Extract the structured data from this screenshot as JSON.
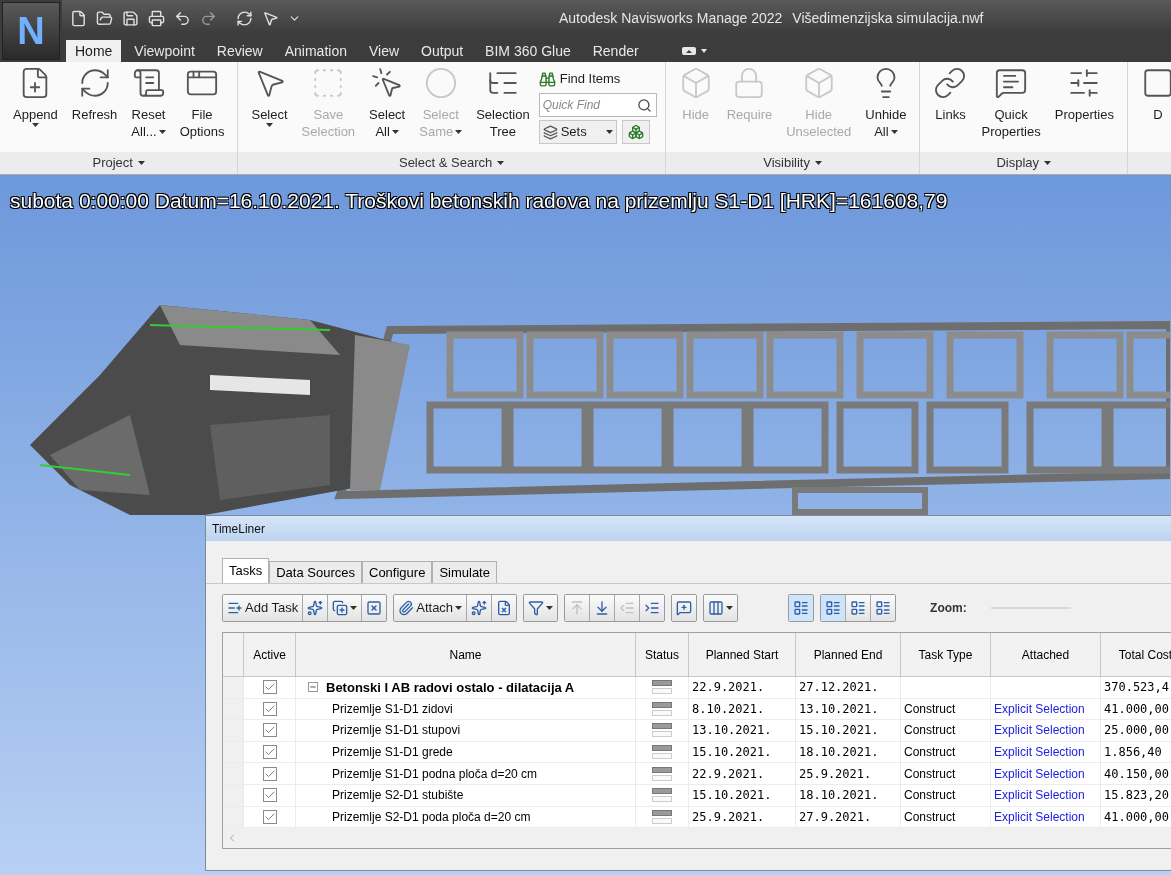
{
  "window": {
    "logo": "N",
    "title": "Autodesk Navisworks Manage 2022",
    "file": "Višedimenzijska simulacija.nwf"
  },
  "tabs": [
    {
      "label": "Home",
      "selected": true
    },
    {
      "label": "Viewpoint",
      "selected": false
    },
    {
      "label": "Review",
      "selected": false
    },
    {
      "label": "Animation",
      "selected": false
    },
    {
      "label": "View",
      "selected": false
    },
    {
      "label": "Output",
      "selected": false
    },
    {
      "label": "BIM 360 Glue",
      "selected": false
    },
    {
      "label": "Render",
      "selected": false
    }
  ],
  "ribbon": {
    "groups": [
      {
        "label": "Project",
        "buttons": [
          {
            "lines": [
              "Append"
            ],
            "dropdown": true,
            "disabled": false
          },
          {
            "lines": [
              "Refresh"
            ],
            "dropdown": false,
            "disabled": false
          },
          {
            "lines": [
              "Reset",
              "All..."
            ],
            "dropdown": true,
            "disabled": false
          },
          {
            "lines": [
              "File",
              "Options"
            ],
            "dropdown": false,
            "disabled": false
          }
        ]
      },
      {
        "label": "Select & Search",
        "buttons": [
          {
            "lines": [
              "Select"
            ],
            "dropdown": true,
            "disabled": false
          },
          {
            "lines": [
              "Save",
              "Selection"
            ],
            "dropdown": false,
            "disabled": true
          },
          {
            "lines": [
              "Select",
              "All"
            ],
            "dropdown": true,
            "disabled": false
          },
          {
            "lines": [
              "Select",
              "Same"
            ],
            "dropdown": true,
            "disabled": true
          },
          {
            "lines": [
              "Selection",
              "Tree"
            ],
            "dropdown": false,
            "disabled": false
          }
        ],
        "tools": {
          "find_label": "Find Items",
          "search": {
            "placeholder": "Quick Find"
          },
          "sets_label": "Sets"
        }
      },
      {
        "label": "Visibility",
        "buttons": [
          {
            "lines": [
              "Hide"
            ],
            "dropdown": false,
            "disabled": true
          },
          {
            "lines": [
              "Require"
            ],
            "dropdown": false,
            "disabled": true
          },
          {
            "lines": [
              "Hide",
              "Unselected"
            ],
            "dropdown": false,
            "disabled": true
          },
          {
            "lines": [
              "Unhide",
              "All"
            ],
            "dropdown": true,
            "disabled": false
          }
        ]
      },
      {
        "label": "Display",
        "buttons": [
          {
            "lines": [
              "Links"
            ],
            "dropdown": false,
            "disabled": false
          },
          {
            "lines": [
              "Quick",
              "Properties"
            ],
            "dropdown": false,
            "disabled": false
          },
          {
            "lines": [
              "Properties"
            ],
            "dropdown": false,
            "disabled": false
          }
        ]
      },
      {
        "buttons": [
          {
            "lines": [
              "D"
            ],
            "dropdown": false,
            "disabled": false
          }
        ]
      }
    ]
  },
  "viewport": {
    "caption": "subota 0:00:00 Datum=16.10.2021. Troškovi betonskih radova na prizemlju S1-D1 [HRK]=161608,79"
  },
  "timeliner": {
    "title": "TimeLiner",
    "tabs": [
      {
        "label": "Tasks",
        "selected": true
      },
      {
        "label": "Data Sources",
        "selected": false
      },
      {
        "label": "Configure",
        "selected": false
      },
      {
        "label": "Simulate",
        "selected": false
      }
    ],
    "toolbar": [
      [
        {
          "kind": "labeled",
          "label": "Add Task",
          "dropdown": false,
          "disabled": false
        },
        {
          "kind": "icon",
          "dropdown": false,
          "disabled": false
        },
        {
          "kind": "icon",
          "dropdown": true,
          "disabled": false
        },
        {
          "kind": "icon",
          "dropdown": false,
          "disabled": false
        }
      ],
      [
        {
          "kind": "labeled",
          "label": "Attach",
          "dropdown": true,
          "disabled": false
        },
        {
          "kind": "icon",
          "dropdown": false,
          "disabled": false
        },
        {
          "kind": "icon",
          "dropdown": false,
          "disabled": false
        }
      ],
      [
        {
          "kind": "icon",
          "dropdown": true,
          "disabled": false
        }
      ],
      [
        {
          "kind": "icon",
          "dropdown": false,
          "disabled": true
        },
        {
          "kind": "icon",
          "dropdown": false,
          "disabled": false
        },
        {
          "kind": "icon",
          "dropdown": false,
          "disabled": true
        },
        {
          "kind": "icon",
          "dropdown": false,
          "disabled": false
        }
      ],
      [
        {
          "kind": "icon",
          "dropdown": false,
          "disabled": false
        }
      ],
      [
        {
          "kind": "icon",
          "dropdown": true,
          "disabled": false
        }
      ],
      [
        {
          "kind": "view",
          "selected": true
        }
      ],
      [
        {
          "kind": "view",
          "selected": true
        },
        {
          "kind": "view",
          "selected": false
        },
        {
          "kind": "view",
          "selected": false
        }
      ]
    ],
    "zoom_label": "Zoom:",
    "columns": [
      "Active",
      "Name",
      "Status",
      "Planned Start",
      "Planned End",
      "Task Type",
      "Attached",
      "Total Cost"
    ],
    "rows": [
      {
        "active": true,
        "name": "Betonski I AB radovi ostalo - dilatacija A",
        "start": "22.9.2021.",
        "end": "27.12.2021.",
        "cost": "370.523,4",
        "expanded": true,
        "children": [
          {
            "active": true,
            "name": "Prizemlje S1-D1 zidovi",
            "start": "8.10.2021.",
            "end": "13.10.2021.",
            "task_type": "Construct",
            "attached": "Explicit Selection",
            "cost": "41.000,00"
          },
          {
            "active": true,
            "name": "Prizemlje S1-D1 stupovi",
            "start": "13.10.2021.",
            "end": "15.10.2021.",
            "task_type": "Construct",
            "attached": "Explicit Selection",
            "cost": "25.000,00"
          },
          {
            "active": true,
            "name": "Prizemlje S1-D1 grede",
            "start": "15.10.2021.",
            "end": "18.10.2021.",
            "task_type": "Construct",
            "attached": "Explicit Selection",
            "cost": "1.856,40"
          },
          {
            "active": true,
            "name": "Prizemlje S1-D1 podna ploča d=20 cm",
            "start": "22.9.2021.",
            "end": "25.9.2021.",
            "task_type": "Construct",
            "attached": "Explicit Selection",
            "cost": "40.150,00"
          },
          {
            "active": true,
            "name": "Prizemlje S2-D1 stubište",
            "start": "15.10.2021.",
            "end": "18.10.2021.",
            "task_type": "Construct",
            "attached": "Explicit Selection",
            "cost": "15.823,20"
          },
          {
            "active": true,
            "name": "Prizemlje S2-D1 poda ploča d=20 cm",
            "start": "25.9.2021.",
            "end": "27.9.2021.",
            "task_type": "Construct",
            "attached": "Explicit Selection",
            "cost": "41.000,00"
          }
        ]
      }
    ]
  }
}
